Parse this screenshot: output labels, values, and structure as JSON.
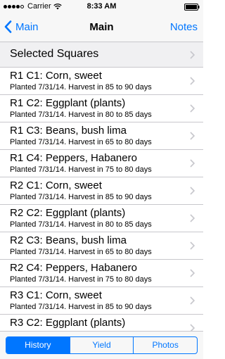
{
  "status_bar": {
    "carrier": "Carrier",
    "time": "8:33 AM"
  },
  "nav": {
    "back_label": "Main",
    "title": "Main",
    "right_label": "Notes"
  },
  "header_row": {
    "label": "Selected Squares"
  },
  "items": [
    {
      "title": "R1 C1: Corn, sweet",
      "subtitle": "Planted 7/31/14. Harvest in 85 to 90 days"
    },
    {
      "title": "R1 C2: Eggplant (plants)",
      "subtitle": "Planted 7/31/14. Harvest in 80 to 85 days"
    },
    {
      "title": "R1 C3: Beans, bush lima",
      "subtitle": "Planted 7/31/14. Harvest in 65 to 80 days"
    },
    {
      "title": "R1 C4: Peppers, Habanero",
      "subtitle": "Planted 7/31/14. Harvest in 75 to 80 days"
    },
    {
      "title": "R2 C1: Corn, sweet",
      "subtitle": "Planted 7/31/14. Harvest in 85 to 90 days"
    },
    {
      "title": "R2 C2: Eggplant (plants)",
      "subtitle": "Planted 7/31/14. Harvest in 80 to 85 days"
    },
    {
      "title": "R2 C3: Beans, bush lima",
      "subtitle": "Planted 7/31/14. Harvest in 65 to 80 days"
    },
    {
      "title": "R2 C4: Peppers, Habanero",
      "subtitle": "Planted 7/31/14. Harvest in 75 to 80 days"
    },
    {
      "title": "R3 C1: Corn, sweet",
      "subtitle": "Planted 7/31/14. Harvest in 85 to 90 days"
    },
    {
      "title": "R3 C2: Eggplant (plants)",
      "subtitle": ""
    }
  ],
  "toolbar": {
    "segments": [
      "History",
      "Yield",
      "Photos"
    ],
    "selected": "History"
  },
  "colors": {
    "accent": "#0076ff",
    "separator": "#c8c7cc",
    "bar_background": "#f7f7f7"
  },
  "icons": {
    "back": "chevron-left-icon",
    "disclosure": "chevron-right-icon",
    "wifi": "wifi-icon",
    "battery": "battery-icon"
  }
}
